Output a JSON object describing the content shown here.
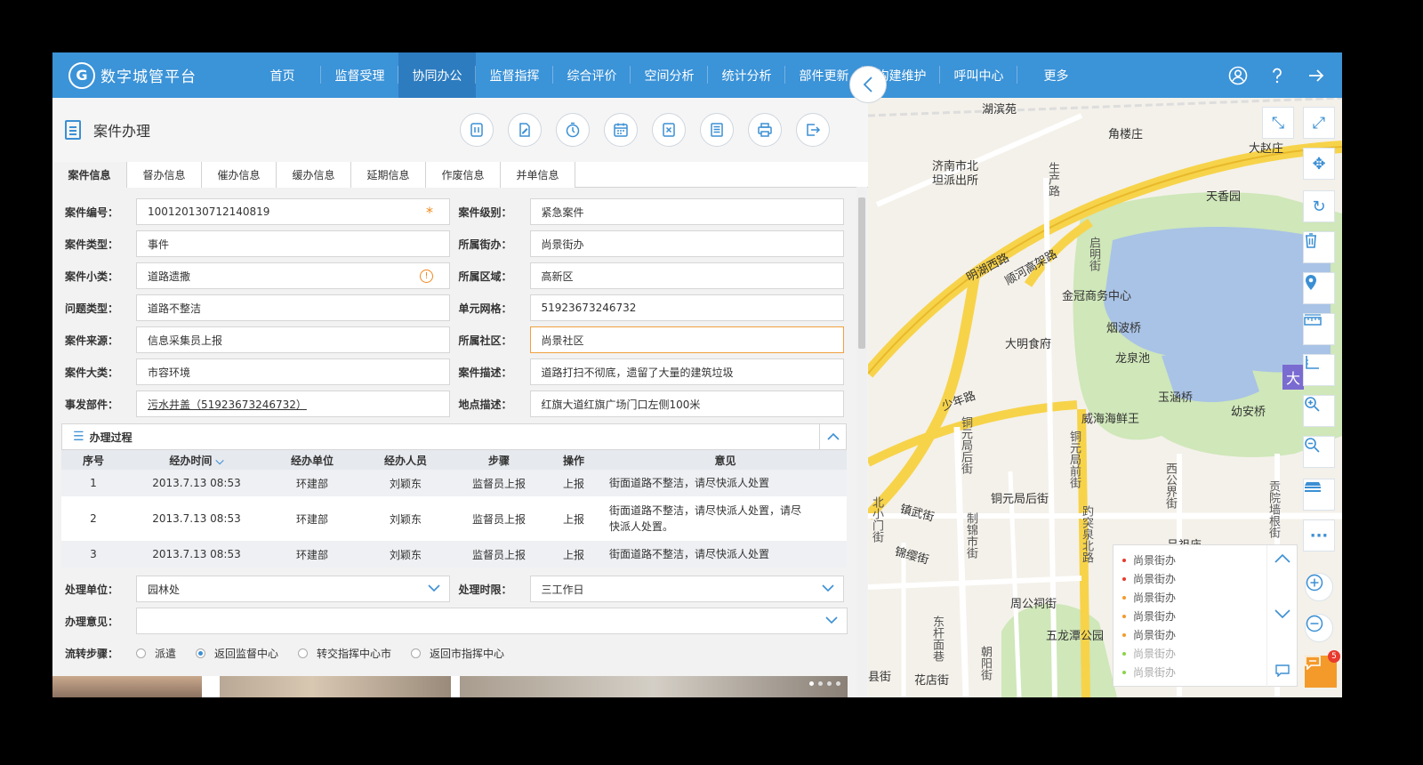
{
  "app": {
    "title": "数字城管平台",
    "logo_letter": "G"
  },
  "nav": {
    "items": [
      "首页",
      "监督受理",
      "协同办公",
      "监督指挥",
      "综合评价",
      "空间分析",
      "统计分析",
      "部件更新",
      "构建维护",
      "呼叫中心",
      "更多"
    ],
    "active": "协同办公",
    "icons": [
      "user-icon",
      "help-icon",
      "logout-icon"
    ]
  },
  "panel": {
    "title": "案件办理",
    "toolbar": [
      "pause-icon",
      "edit-icon",
      "timer-icon",
      "calendar-icon",
      "cancel-icon",
      "list-icon",
      "print-icon",
      "export-icon"
    ]
  },
  "tabs": [
    "案件信息",
    "督办信息",
    "催办信息",
    "缓办信息",
    "延期信息",
    "作废信息",
    "并单信息"
  ],
  "form": {
    "case_no": {
      "label": "案件编号：",
      "value": "100120130712140819"
    },
    "case_level": {
      "label": "案件级别：",
      "value": "紧急案件"
    },
    "case_type": {
      "label": "案件类型：",
      "value": "事件"
    },
    "street": {
      "label": "所属街办：",
      "value": "尚景街办"
    },
    "sub_type": {
      "label": "案件小类：",
      "value": "道路遗撒"
    },
    "district": {
      "label": "所属区域：",
      "value": "高新区"
    },
    "problem_type": {
      "label": "问题类型：",
      "value": "道路不整洁"
    },
    "grid": {
      "label": "单元网格：",
      "value": "51923673246732"
    },
    "source": {
      "label": "案件来源：",
      "value": "信息采集员上报"
    },
    "community": {
      "label": "所属社区：",
      "value": "尚景社区"
    },
    "category": {
      "label": "案件大类：",
      "value": "市容环境"
    },
    "description": {
      "label": "案件描述：",
      "value": "道路打扫不彻底，遗留了大量的建筑垃圾"
    },
    "component": {
      "label": "事发部件：",
      "value": "污水井盖（51923673246732）"
    },
    "location": {
      "label": "地点描述：",
      "value": "红旗大道红旗广场门口左侧100米"
    }
  },
  "process": {
    "title": "办理过程",
    "columns": [
      "序号",
      "经办时间",
      "经办单位",
      "经办人员",
      "步骤",
      "操作",
      "意见"
    ],
    "rows": [
      {
        "no": "1",
        "time": "2013.7.13   08:53",
        "unit": "环建部",
        "person": "刘颖东",
        "step": "监督员上报",
        "op": "上报",
        "opinion": "街面道路不整洁，请尽快派人处置"
      },
      {
        "no": "2",
        "time": "2013.7.13   08:53",
        "unit": "环建部",
        "person": "刘颖东",
        "step": "监督员上报",
        "op": "上报",
        "opinion": "街面道路不整洁，请尽快派人处置，请尽快派人处置。"
      },
      {
        "no": "3",
        "time": "2013.7.13   08:53",
        "unit": "环建部",
        "person": "刘颖东",
        "step": "监督员上报",
        "op": "上报",
        "opinion": "街面道路不整洁，请尽快派人处置"
      }
    ]
  },
  "handling": {
    "unit_label": "处理单位：",
    "unit_value": "园林处",
    "period_label": "处理时限：",
    "period_value": "三工作日",
    "opinion_label": "办理意见：",
    "opinion_value": ""
  },
  "flow": {
    "label": "流转步骤：",
    "options": [
      "派遣",
      "返回监督中心",
      "转交指挥中心市",
      "返回市指挥中心"
    ],
    "selected": "返回监督中心"
  },
  "map": {
    "labels": [
      "湖滨苑",
      "角楼庄",
      "大赵庄",
      "济南市北",
      "坦派出所",
      "生产路",
      "天香园",
      "明湖西路",
      "顺河高架路",
      "启明街",
      "金冠商务中心",
      "烟波桥",
      "大明食府",
      "龙泉池",
      "玉涵桥",
      "幼安桥",
      "威海海鲜王",
      "少年路",
      "铜元局后街",
      "铜元局前街",
      "铜元局后街",
      "西公界街",
      "贡院墙根街",
      "镇武街",
      "制锦市街",
      "锦缨街",
      "趵突泉北路",
      "周公祠街",
      "五龙潭公园",
      "东杆面巷",
      "朝阳街",
      "花店街",
      "北小门街",
      "大",
      "县街",
      "吕祖庙"
    ],
    "legend": [
      {
        "text": "尚景街办",
        "color": "#e83a2e"
      },
      {
        "text": "尚景街办",
        "color": "#e83a2e"
      },
      {
        "text": "尚景街办",
        "color": "#f39a2b"
      },
      {
        "text": "尚景街办",
        "color": "#f39a2b"
      },
      {
        "text": "尚景街办",
        "color": "#f39a2b"
      },
      {
        "text": "尚景街办",
        "color": "#8bd34a"
      },
      {
        "text": "尚景街办",
        "color": "#8bd34a"
      }
    ],
    "chat_badge": "5"
  }
}
